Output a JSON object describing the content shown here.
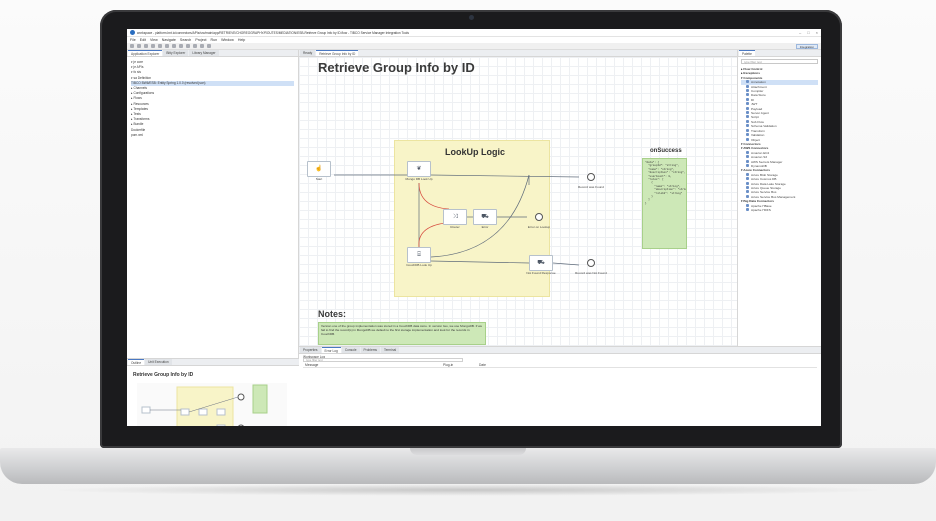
{
  "window": {
    "title": "workspace - platform.bnt.io/connectors/APIs/src/main/app/RETRIEVE/CHOREOGRAPHY/ROUTES/MEDIATION/ESB-Retrieve Group Info by ID.flow - TIBCO Service Manager Integration Tools"
  },
  "menu": [
    "File",
    "Edit",
    "View",
    "Navigate",
    "Search",
    "Project",
    "Run",
    "Window",
    "Help"
  ],
  "perspective": "Integration",
  "left_tabs": [
    "Application Explorer",
    "Bitty Explorer",
    "Library Manager"
  ],
  "tree": [
    "▾ je core",
    "  ▾ je APIs",
    "    ▾ fo sis",
    "      ▾ sa Definition",
    "        TIBCO BW6/ESB: Entity Spring 1.0.0 (resolved json)",
    "  ▸ Channels",
    "  ▸ Configurations",
    "  ▸ Flows",
    "  ▸ Resources",
    "  ▸ Templates",
    "  ▸ Tests",
    "  ▸ Transforms",
    "  ▸ Bundle",
    "    Dockerfile",
    "    pom.xml"
  ],
  "outline_tabs": [
    "Outline",
    "Unit Execution"
  ],
  "outline_title": "Retrieve Group Info by ID",
  "editor_tabs": [
    "Ready",
    "Retrieve Group Info by ID"
  ],
  "flow": {
    "title": "Retrieve Group Info by ID",
    "logic_title": "LookUp Logic",
    "nodes": {
      "start": "Start",
      "mongo": "Mongo DB Look Up",
      "couch": "CouchDB Look Up",
      "router": "Router",
      "error_mid": "Error",
      "error_lookup": "Error on Lookup",
      "record_found": "Record was Found",
      "not_found_response": "Not Found Response",
      "record_not_found": "Record was Not Found"
    },
    "success_title": "onSuccess",
    "success_json": "\"data\": {\n  \"groupId\": \"string\",\n  \"name\": \"string\",\n  \"description\": \"string\",\n  \"userCount\": 0,\n  \"roles\": [\n    {\n      \"name\": \"string\",\n      \"description\": \"string\",\n      \"roleId\": \"string\"\n    }\n  ]\n}",
    "notes_title": "Notes:",
    "notes_text": "Version one of the group implementation was stored in a CouchDB data store. In version two, we use MongoDB. If we fail to find the record(s) in MongoDB we default to the first storage implementation and look for the records in CouchDB."
  },
  "palette": {
    "search_placeholder": "type filter text",
    "title": "Palette",
    "items": [
      {
        "kind": "hd",
        "label": "▸ Flow Control"
      },
      {
        "kind": "hd",
        "label": "▸ Exceptions"
      },
      {
        "kind": "hd",
        "label": "▾ Components"
      },
      {
        "kind": "it",
        "label": "Annotation",
        "sel": true
      },
      {
        "kind": "it",
        "label": "Attachment"
      },
      {
        "kind": "it",
        "label": "Compiler"
      },
      {
        "kind": "it",
        "label": "Data Store"
      },
      {
        "kind": "it",
        "label": "DI"
      },
      {
        "kind": "it",
        "label": "JWT"
      },
      {
        "kind": "it",
        "label": "Payload"
      },
      {
        "kind": "it",
        "label": "Server Agent"
      },
      {
        "kind": "it",
        "label": "Script"
      },
      {
        "kind": "it",
        "label": "Sub Flow"
      },
      {
        "kind": "it",
        "label": "Schema Validation"
      },
      {
        "kind": "it",
        "label": "Transform"
      },
      {
        "kind": "it",
        "label": "Validation"
      },
      {
        "kind": "it",
        "label": "Object"
      },
      {
        "kind": "hd",
        "label": "▾ Connectors"
      },
      {
        "kind": "hd",
        "label": "▾ AWS Connectors"
      },
      {
        "kind": "it",
        "label": "Amazon EC2"
      },
      {
        "kind": "it",
        "label": "Amazon S3"
      },
      {
        "kind": "it",
        "label": "AWS Secrets Manager"
      },
      {
        "kind": "it",
        "label": "DynamoDB"
      },
      {
        "kind": "hd",
        "label": "▾ Azure Connectors"
      },
      {
        "kind": "it",
        "label": "Azure Blob Storage"
      },
      {
        "kind": "it",
        "label": "Azure Cosmos DB"
      },
      {
        "kind": "it",
        "label": "Azure Data Lake Storage"
      },
      {
        "kind": "it",
        "label": "Azure Queue Storage"
      },
      {
        "kind": "it",
        "label": "Azure Service Bus"
      },
      {
        "kind": "it",
        "label": "Azure Service Bus Management"
      },
      {
        "kind": "hd",
        "label": "▾ Big Data Connectors"
      },
      {
        "kind": "it",
        "label": "Apache HBase"
      },
      {
        "kind": "it",
        "label": "Apache HDFS"
      }
    ]
  },
  "bottom_tabs": [
    "Properties",
    "Error Log",
    "Console",
    "Problems",
    "Terminal"
  ],
  "error_log": {
    "workspace_label": "Workspace Log",
    "filter_placeholder": "type filter text",
    "columns": [
      "Message",
      "Plug-in",
      "Date"
    ]
  }
}
